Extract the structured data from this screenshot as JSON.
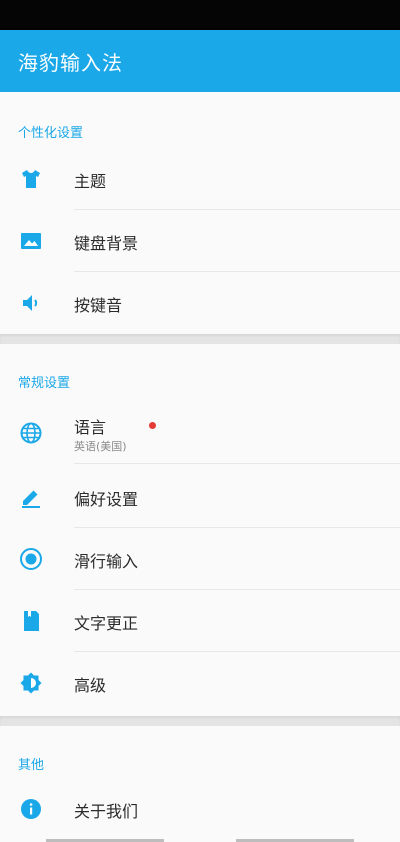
{
  "app": {
    "title": "海豹输入法"
  },
  "sections": [
    {
      "header": "个性化设置",
      "items": [
        {
          "label": "主题",
          "icon": "shirt-icon"
        },
        {
          "label": "键盘背景",
          "icon": "image-icon"
        },
        {
          "label": "按键音",
          "icon": "volume-icon"
        }
      ]
    },
    {
      "header": "常规设置",
      "items": [
        {
          "label": "语言",
          "sublabel": "英语(美国)",
          "icon": "globe-icon",
          "badge": "new-dot"
        },
        {
          "label": "偏好设置",
          "icon": "pencil-icon"
        },
        {
          "label": "滑行输入",
          "icon": "radio-target-icon"
        },
        {
          "label": "文字更正",
          "icon": "bookmark-note-icon"
        },
        {
          "label": "高级",
          "icon": "brightness-icon"
        }
      ]
    },
    {
      "header": "其他",
      "items": [
        {
          "label": "关于我们",
          "icon": "info-icon"
        }
      ]
    }
  ],
  "colors": {
    "accent": "#1aa8e8",
    "badge": "#e53935"
  }
}
